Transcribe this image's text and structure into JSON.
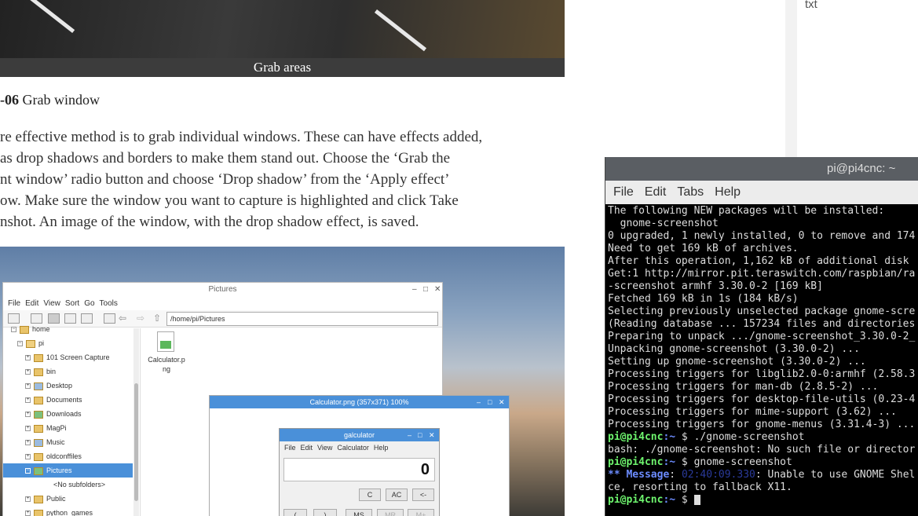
{
  "top_image": {
    "caption": "Grab areas"
  },
  "article": {
    "step_number": "-06",
    "step_title": " Grab window",
    "paragraph_lines": [
      "re effective method is to grab individual windows. These can have effects added,",
      "as drop shadows and borders to make them stand out. Choose the ‘Grab the",
      "nt window’ radio button and choose ‘Drop shadow’ from the ‘Apply effect’",
      "ow. Make sure the window you want to capture is highlighted and click Take",
      "nshot. An image of the window, with the drop shadow effect, is saved."
    ]
  },
  "right_column": {
    "label": "txt"
  },
  "screenshot": {
    "file_manager": {
      "title": "Pictures",
      "menu": [
        "File",
        "Edit",
        "View",
        "Sort",
        "Go",
        "Tools"
      ],
      "path": "/home/pi/Pictures",
      "tree": [
        {
          "label": "home",
          "level": 0
        },
        {
          "label": "pi",
          "level": 1
        },
        {
          "label": "101 Screen Capture",
          "level": 2
        },
        {
          "label": "bin",
          "level": 2
        },
        {
          "label": "Desktop",
          "level": 2
        },
        {
          "label": "Documents",
          "level": 2
        },
        {
          "label": "Downloads",
          "level": 2
        },
        {
          "label": "MagPi",
          "level": 2
        },
        {
          "label": "Music",
          "level": 2
        },
        {
          "label": "oldconffiles",
          "level": 2
        },
        {
          "label": "Pictures",
          "level": 2,
          "selected": true
        },
        {
          "label": "<No subfolders>",
          "level": 3
        },
        {
          "label": "Public",
          "level": 2
        },
        {
          "label": "python_games",
          "level": 2
        }
      ],
      "file": {
        "name": "Calculator.p\nng"
      }
    },
    "viewer": {
      "title": "Calculator.png (357x371) 100%"
    },
    "calculator": {
      "title": "galculator",
      "menu": [
        "File",
        "Edit",
        "View",
        "Calculator",
        "Help"
      ],
      "display": "0",
      "buttons_row1": [
        "C",
        "AC",
        "<-"
      ],
      "buttons_row2": [
        "(",
        ")",
        "MS",
        "MR",
        "M+"
      ]
    }
  },
  "terminal": {
    "title": "pi@pi4cnc: ~",
    "menu": [
      "File",
      "Edit",
      "Tabs",
      "Help"
    ],
    "lines": [
      {
        "type": "text",
        "text": "The following NEW packages will be installed:"
      },
      {
        "type": "text",
        "text": "  gnome-screenshot"
      },
      {
        "type": "text",
        "text": "0 upgraded, 1 newly installed, 0 to remove and 174"
      },
      {
        "type": "text",
        "text": "Need to get 169 kB of archives."
      },
      {
        "type": "text",
        "text": "After this operation, 1,162 kB of additional disk"
      },
      {
        "type": "text",
        "text": "Get:1 http://mirror.pit.teraswitch.com/raspbian/ra"
      },
      {
        "type": "text",
        "text": "-screenshot armhf 3.30.0-2 [169 kB]"
      },
      {
        "type": "text",
        "text": "Fetched 169 kB in 1s (184 kB/s)"
      },
      {
        "type": "text",
        "text": "Selecting previously unselected package gnome-scre"
      },
      {
        "type": "text",
        "text": "(Reading database ... 157234 files and directories"
      },
      {
        "type": "text",
        "text": "Preparing to unpack .../gnome-screenshot_3.30.0-2_"
      },
      {
        "type": "text",
        "text": "Unpacking gnome-screenshot (3.30.0-2) ..."
      },
      {
        "type": "text",
        "text": "Setting up gnome-screenshot (3.30.0-2) ..."
      },
      {
        "type": "text",
        "text": "Processing triggers for libglib2.0-0:armhf (2.58.3"
      },
      {
        "type": "text",
        "text": "Processing triggers for man-db (2.8.5-2) ..."
      },
      {
        "type": "text",
        "text": "Processing triggers for desktop-file-utils (0.23-4"
      },
      {
        "type": "text",
        "text": "Processing triggers for mime-support (3.62) ..."
      },
      {
        "type": "text",
        "text": "Processing triggers for gnome-menus (3.31.4-3) ..."
      },
      {
        "type": "prompt",
        "user": "pi@pi4cnc",
        "path": ":~",
        "cmd": " $ ./gnome-screenshot"
      },
      {
        "type": "text",
        "text": "bash: ./gnome-screenshot: No such file or director"
      },
      {
        "type": "prompt",
        "user": "pi@pi4cnc",
        "path": ":~",
        "cmd": " $ gnome-screenshot"
      },
      {
        "type": "message",
        "label": "** Message",
        "ts": "02:40:09.330",
        "text": ": Unable to use GNOME Shel"
      },
      {
        "type": "text",
        "text": "ce, resorting to fallback X11."
      },
      {
        "type": "prompt_cursor",
        "user": "pi@pi4cnc",
        "path": ":~",
        "cmd": " $ "
      }
    ]
  },
  "colors": {
    "terminal_prompt": "#6ef56e",
    "terminal_path": "#6c8cff",
    "selection": "#4a90d9"
  }
}
